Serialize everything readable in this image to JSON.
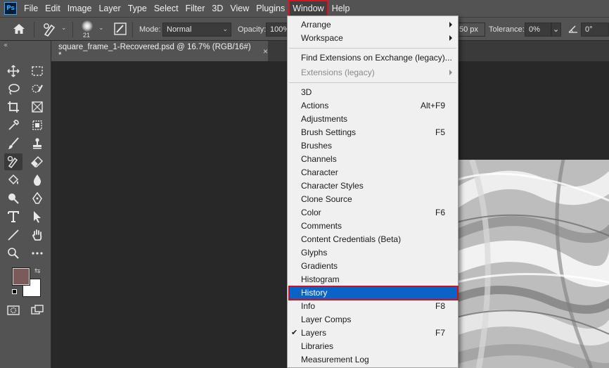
{
  "app": {
    "logo_text": "Ps"
  },
  "menubar": {
    "items": [
      "File",
      "Edit",
      "Image",
      "Layer",
      "Type",
      "Select",
      "Filter",
      "3D",
      "View",
      "Plugins",
      "Window",
      "Help"
    ],
    "active": "Window"
  },
  "options": {
    "brush_size": "21",
    "mode_label": "Mode:",
    "mode_value": "Normal",
    "opacity_label": "Opacity:",
    "opacity_value": "100%",
    "size_value": "50 px",
    "tolerance_label": "Tolerance:",
    "tolerance_value": "0%",
    "angle_value": "0°"
  },
  "document": {
    "tab_title": "square_frame_1-Recovered.psd @ 16.7% (RGB/16#) *",
    "close_glyph": "×"
  },
  "colors": {
    "foreground": "#7b5a5a",
    "background": "#ffffff",
    "highlight": "#0a64c8",
    "annotation": "#d0101e"
  },
  "window_menu": {
    "items": [
      {
        "label": "Arrange",
        "submenu": true
      },
      {
        "label": "Workspace",
        "submenu": true
      },
      {
        "separator": true
      },
      {
        "label": "Find Extensions on Exchange (legacy)..."
      },
      {
        "label": "Extensions (legacy)",
        "submenu": true,
        "disabled": true
      },
      {
        "separator": true
      },
      {
        "label": "3D"
      },
      {
        "label": "Actions",
        "shortcut": "Alt+F9"
      },
      {
        "label": "Adjustments"
      },
      {
        "label": "Brush Settings",
        "shortcut": "F5"
      },
      {
        "label": "Brushes"
      },
      {
        "label": "Channels"
      },
      {
        "label": "Character"
      },
      {
        "label": "Character Styles"
      },
      {
        "label": "Clone Source"
      },
      {
        "label": "Color",
        "shortcut": "F6"
      },
      {
        "label": "Comments"
      },
      {
        "label": "Content Credentials (Beta)"
      },
      {
        "label": "Glyphs"
      },
      {
        "label": "Gradients"
      },
      {
        "label": "Histogram"
      },
      {
        "label": "History",
        "highlighted": true
      },
      {
        "label": "Info",
        "shortcut": "F8"
      },
      {
        "label": "Layer Comps"
      },
      {
        "label": "Layers",
        "shortcut": "F7",
        "checked": true
      },
      {
        "label": "Libraries"
      },
      {
        "label": "Measurement Log"
      }
    ]
  }
}
